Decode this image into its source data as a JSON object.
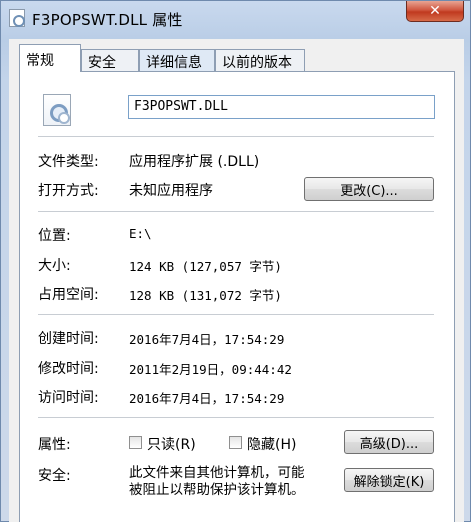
{
  "window": {
    "title": "F3POPSWT.DLL 属性",
    "close_glyph": "✕"
  },
  "tabs": [
    {
      "label": "常规"
    },
    {
      "label": "安全"
    },
    {
      "label": "详细信息"
    },
    {
      "label": "以前的版本"
    }
  ],
  "general": {
    "file_name": "F3POPSWT.DLL",
    "file_type_label": "文件类型:",
    "file_type_value": "应用程序扩展 (.DLL)",
    "opens_with_label": "打开方式:",
    "opens_with_value": "未知应用程序",
    "change_button": "更改(C)...",
    "location_label": "位置:",
    "location_value": "E:\\",
    "size_label": "大小:",
    "size_value": "124 KB (127,057 字节)",
    "size_on_disk_label": "占用空间:",
    "size_on_disk_value": "128 KB (131,072 字节)",
    "created_label": "创建时间:",
    "created_value": "2016年7月4日，17:54:29",
    "modified_label": "修改时间:",
    "modified_value": "2011年2月19日，09:44:42",
    "accessed_label": "访问时间:",
    "accessed_value": "2016年7月4日，17:54:29",
    "attributes_label": "属性:",
    "readonly_label": "只读(R)",
    "hidden_label": "隐藏(H)",
    "advanced_button": "高级(D)...",
    "security_label": "安全:",
    "security_line1": "此文件来自其他计算机，可能",
    "security_line2": "被阻止以帮助保护该计算机。",
    "unblock_button": "解除锁定(K)"
  }
}
